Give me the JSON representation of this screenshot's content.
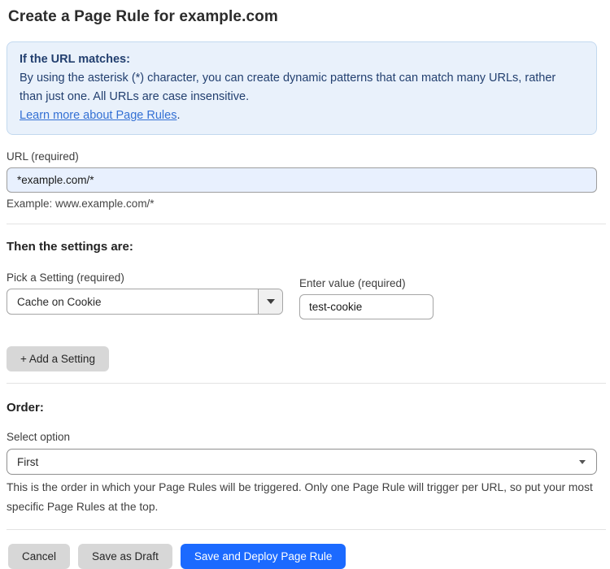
{
  "page": {
    "title": "Create a Page Rule for example.com"
  },
  "info_box": {
    "heading": "If the URL matches:",
    "body": "By using the asterisk (*) character, you can create dynamic patterns that can match many URLs, rather than just one. All URLs are case insensitive.",
    "link_label": "Learn more about Page Rules",
    "link_suffix": "."
  },
  "url_field": {
    "label": "URL (required)",
    "value": "*example.com/*",
    "helper": "Example: www.example.com/*"
  },
  "settings_section": {
    "heading": "Then the settings are:",
    "setting_label": "Pick a Setting (required)",
    "setting_selected": "Cache on Cookie",
    "value_label": "Enter value (required)",
    "value_text": "test-cookie",
    "add_setting_label": "+ Add a Setting"
  },
  "order_section": {
    "heading": "Order:",
    "select_label": "Select option",
    "selected_option": "First",
    "helper": "This is the order in which your Page Rules will be triggered. Only one Page Rule will trigger per URL, so put your most specific Page Rules at the top."
  },
  "actions": {
    "cancel_label": "Cancel",
    "save_draft_label": "Save as Draft",
    "save_deploy_label": "Save and Deploy Page Rule"
  },
  "colors": {
    "info_box_bg": "#e9f1fb",
    "info_box_border": "#c3d9ef",
    "info_box_text": "#223f6f",
    "link_blue": "#3370d4",
    "url_input_bg": "#e8f0fe",
    "primary_button_bg": "#1b6aff",
    "secondary_button_bg": "#d7d7d7"
  }
}
